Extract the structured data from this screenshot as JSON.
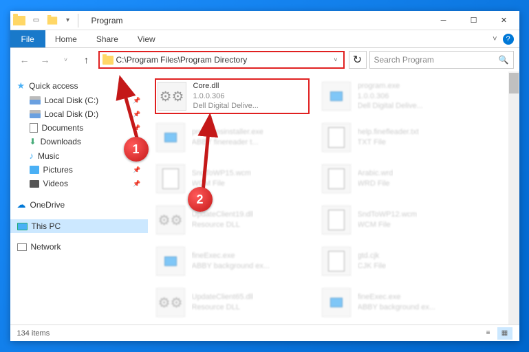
{
  "window": {
    "title": "Program"
  },
  "ribbon": {
    "file": "File",
    "tabs": [
      "Home",
      "Share",
      "View"
    ]
  },
  "address": {
    "path": "C:\\Program Files\\Program Directory"
  },
  "search": {
    "placeholder": "Search Program"
  },
  "nav": {
    "quick_access": "Quick access",
    "items": [
      {
        "label": "Local Disk (C:)"
      },
      {
        "label": "Local Disk (D:)"
      },
      {
        "label": "Documents"
      },
      {
        "label": "Downloads"
      },
      {
        "label": "Music"
      },
      {
        "label": "Pictures"
      },
      {
        "label": "Videos"
      }
    ],
    "onedrive": "OneDrive",
    "this_pc": "This PC",
    "network": "Network"
  },
  "files": {
    "highlighted": {
      "name": "Core.dll",
      "version": "1.0.0.306",
      "vendor": "Dell Digital Delive..."
    },
    "others": [
      {
        "name": "program.exe",
        "line2": "1.0.0.306",
        "line3": "Dell Digital Delive..."
      },
      {
        "name": "programsinstaller.exe",
        "line2": "ABBY finereader t...",
        "line3": ""
      },
      {
        "name": "help.finefleader.txt",
        "line2": "TXT File",
        "line3": ""
      },
      {
        "name": "SndToWP15.wcm",
        "line2": "WCM File",
        "line3": ""
      },
      {
        "name": "Arabic.wrd",
        "line2": "WRD File",
        "line3": ""
      },
      {
        "name": "UpdateClient19.dll",
        "line2": "Resource DLL",
        "line3": ""
      },
      {
        "name": "SndToWP12.wcm",
        "line2": "WCM File",
        "line3": ""
      },
      {
        "name": "fineExec.exe",
        "line2": "ABBY background ex...",
        "line3": ""
      },
      {
        "name": "gtd.cjk",
        "line2": "CJK File",
        "line3": ""
      },
      {
        "name": "UpdateClient65.dll",
        "line2": "Resource DLL",
        "line3": ""
      },
      {
        "name": "fineExec.exe",
        "line2": "ABBY background ex...",
        "line3": ""
      }
    ]
  },
  "status": {
    "count": "134 items"
  },
  "callouts": {
    "one": "1",
    "two": "2"
  }
}
